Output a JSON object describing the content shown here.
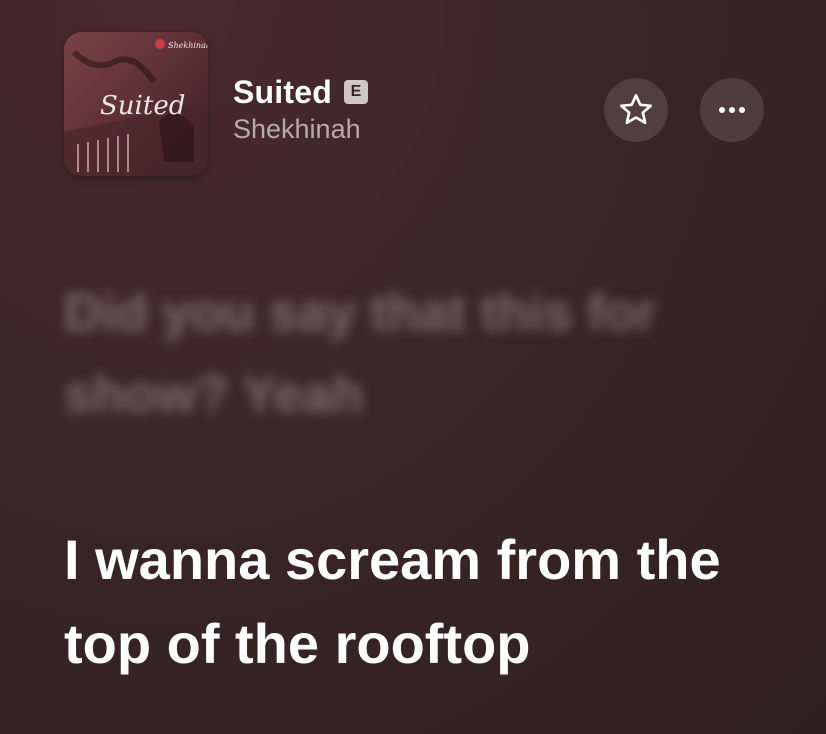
{
  "track": {
    "title": "Suited",
    "explicit_label": "E",
    "artist": "Shekhinah"
  },
  "artwork": {
    "script_text": "Suited",
    "top_text": "Shekhinah"
  },
  "actions": {
    "favorite_icon": "star-outline",
    "more_icon": "ellipsis"
  },
  "lyrics": {
    "past_line": "Did you say that this for show? Yeah",
    "current_line": "I wanna scream from the top of the rooftop"
  },
  "colors": {
    "background": "#3a2527",
    "badge": "#cfc6c7",
    "artist_text": "#b9aaac"
  }
}
